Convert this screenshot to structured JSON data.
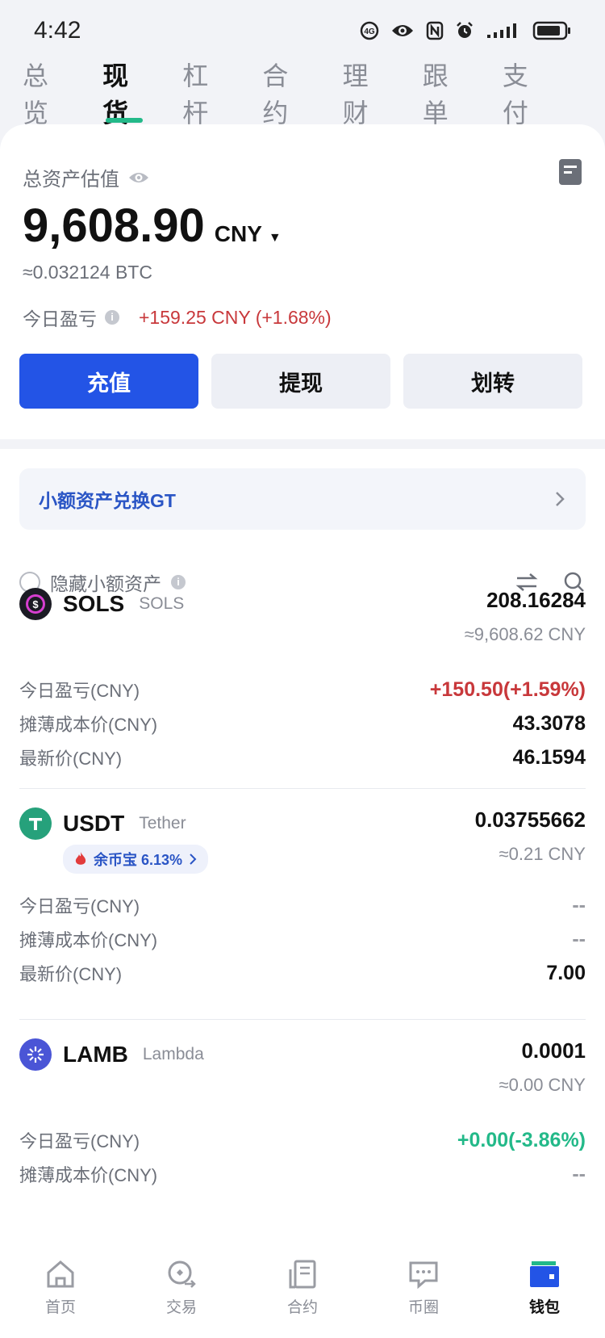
{
  "status": {
    "time": "4:42"
  },
  "tabs": [
    "总览",
    "现货",
    "杠杆",
    "合约",
    "理财",
    "跟单",
    "支付"
  ],
  "summary": {
    "label": "总资产估值",
    "value": "9,608.90",
    "currency": "CNY",
    "btc_value": "≈0.032124 BTC",
    "pnl_label": "今日盈亏",
    "pnl_value": "+159.25 CNY (+1.68%)"
  },
  "actions": {
    "deposit": "充值",
    "withdraw": "提现",
    "transfer": "划转"
  },
  "banner": {
    "text": "小额资产兑换GT"
  },
  "filter": {
    "hide_small": "隐藏小额资产"
  },
  "labels": {
    "pnl": "今日盈亏(CNY)",
    "cost": "摊薄成本价(CNY)",
    "price": "最新价(CNY)"
  },
  "assets": [
    {
      "symbol": "SOLS",
      "name": "SOLS",
      "amount": "208.16284",
      "cny": "≈9,608.62 CNY",
      "pnl": "+150.50(+1.59%)",
      "cost": "43.3078",
      "price": "46.1594"
    },
    {
      "symbol": "USDT",
      "name": "Tether",
      "badge": "余币宝 6.13%",
      "amount": "0.03755662",
      "cny": "≈0.21 CNY",
      "pnl": "--",
      "cost": "--",
      "price": "7.00"
    },
    {
      "symbol": "LAMB",
      "name": "Lambda",
      "amount": "0.0001",
      "cny": "≈0.00 CNY",
      "pnl": "+0.00(-3.86%)",
      "cost": "--"
    }
  ],
  "nav": [
    "首页",
    "交易",
    "合约",
    "币圈",
    "钱包"
  ],
  "colors": {
    "accent": "#2354e6",
    "green": "#23b989",
    "red": "#c8383b"
  }
}
